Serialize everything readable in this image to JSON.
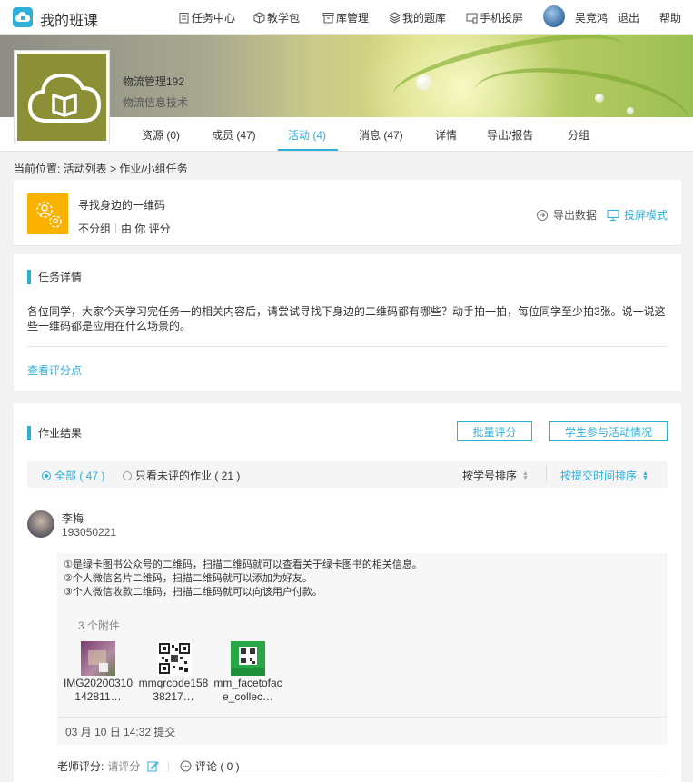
{
  "app": {
    "title": "我的班课"
  },
  "nav": {
    "items": [
      {
        "label": "任务中心"
      },
      {
        "label": "教学包"
      },
      {
        "label": "库管理"
      },
      {
        "label": "我的题库"
      },
      {
        "label": "手机投屏"
      }
    ],
    "user_name": "吴竞鸿",
    "logout": "退出",
    "help": "帮助"
  },
  "course": {
    "name": "物流管理192",
    "subtitle": "物流信息技术",
    "tabs": [
      {
        "label": "资源 (0)"
      },
      {
        "label": "成员 (47)"
      },
      {
        "label": "活动 (4)",
        "active": true
      },
      {
        "label": "消息 (47)"
      },
      {
        "label": "详情"
      },
      {
        "label": "导出/报告"
      },
      {
        "label": "分组"
      }
    ]
  },
  "breadcrumb": "当前位置: 活动列表 > 作业/小组任务",
  "activity": {
    "title": "寻找身边的一维码",
    "group": "不分组",
    "rating": "由 你 评分",
    "export_label": "导出数据",
    "projection_label": "投屏模式"
  },
  "task": {
    "section_title": "任务详情",
    "description": "各位同学，大家今天学习完任务一的相关内容后，请尝试寻找下身边的二维码都有哪些？动手拍一拍，每位同学至少拍3张。说一说这些一维码都是应用在什么场景的。",
    "view_rubric": "查看评分点"
  },
  "results": {
    "section_title": "作业结果",
    "batch_rate_label": "批量评分",
    "participation_label": "学生参与活动情况",
    "filter_all": "全部 ( 47 )",
    "filter_unrated": "只看未评的作业 ( 21 )",
    "sort_by_id": "按学号排序",
    "sort_by_time": "按提交时间排序",
    "submission": {
      "student_name": "李梅",
      "student_id": "193050221",
      "answer_lines": [
        "①是绿卡图书公众号的二维码，扫描二维码就可以查看关于绿卡图书的相关信息。",
        "②个人微信名片二维码，扫描二维码就可以添加为好友。",
        "③个人微信收款二维码，扫描二维码就可以向该用户付款。"
      ],
      "attachment_count": "3 个附件",
      "attachments": [
        {
          "name": "IMG20200310142811…"
        },
        {
          "name": "mmqrcode15838217…"
        },
        {
          "name": "mm_facetoface_collec…"
        }
      ],
      "submit_time": "03 月 10 日 14:32 提交",
      "teacher_rate_label": "老师评分:",
      "rate_pending": "请评分",
      "comment_label": "评论 ( 0 )"
    }
  },
  "colors": {
    "accent": "#2fb0d9",
    "activity_icon": "#fbb100",
    "cover": "#8b8f36"
  }
}
